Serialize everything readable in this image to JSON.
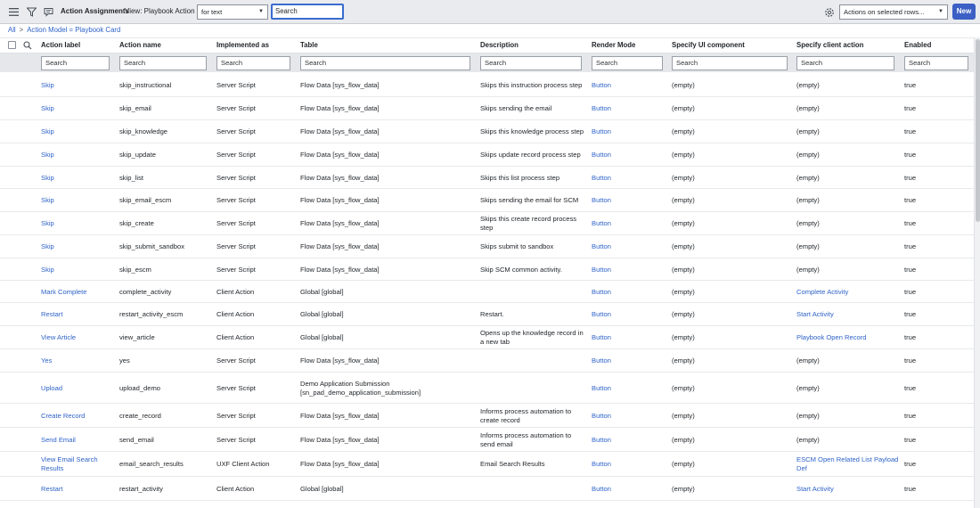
{
  "header": {
    "title": "Action Assignments",
    "view_label": "View: Playbook Action",
    "search_field": "for text",
    "search_placeholder": "Search",
    "actions_select": "Actions on selected rows...",
    "new_button": "New",
    "icons": [
      "hamburger-menu-icon",
      "filter-icon",
      "chat-bubble-icon",
      "gear-icon"
    ]
  },
  "breadcrumb": {
    "all": "All",
    "separator": ">",
    "filter": "Action Model = Playbook Card"
  },
  "columns": [
    "Action label",
    "Action name",
    "Implemented as",
    "Table",
    "Description",
    "Render Mode",
    "Specify UI component",
    "Specify client action",
    "Enabled"
  ],
  "filter_placeholder": "Search",
  "rows": [
    {
      "label": "Skip",
      "name": "skip_instructional",
      "impl": "Server Script",
      "table": "Flow Data [sys_flow_data]",
      "desc": "Skips this instruction process step",
      "render": "Button",
      "ui": "(empty)",
      "client": "(empty)",
      "enabled": "true"
    },
    {
      "label": "Skip",
      "name": "skip_email",
      "impl": "Server Script",
      "table": "Flow Data [sys_flow_data]",
      "desc": "Skips sending the email",
      "render": "Button",
      "ui": "(empty)",
      "client": "(empty)",
      "enabled": "true"
    },
    {
      "label": "Skip",
      "name": "skip_knowledge",
      "impl": "Server Script",
      "table": "Flow Data [sys_flow_data]",
      "desc": "Skips this knowledge process step",
      "render": "Button",
      "ui": "(empty)",
      "client": "(empty)",
      "enabled": "true"
    },
    {
      "label": "Skip",
      "name": "skip_update",
      "impl": "Server Script",
      "table": "Flow Data [sys_flow_data]",
      "desc": "Skips update record process step",
      "render": "Button",
      "ui": "(empty)",
      "client": "(empty)",
      "enabled": "true"
    },
    {
      "label": "Skip",
      "name": "skip_list",
      "impl": "Server Script",
      "table": "Flow Data [sys_flow_data]",
      "desc": "Skips this list process step",
      "render": "Button",
      "ui": "(empty)",
      "client": "(empty)",
      "enabled": "true"
    },
    {
      "label": "Skip",
      "name": "skip_email_escm",
      "impl": "Server Script",
      "table": "Flow Data [sys_flow_data]",
      "desc": "Skips sending the email for SCM",
      "render": "Button",
      "ui": "(empty)",
      "client": "(empty)",
      "enabled": "true"
    },
    {
      "label": "Skip",
      "name": "skip_create",
      "impl": "Server Script",
      "table": "Flow Data [sys_flow_data]",
      "desc": "Skips this create record process step",
      "render": "Button",
      "ui": "(empty)",
      "client": "(empty)",
      "enabled": "true"
    },
    {
      "label": "Skip",
      "name": "skip_submit_sandbox",
      "impl": "Server Script",
      "table": "Flow Data [sys_flow_data]",
      "desc": "Skips submit to sandbox",
      "render": "Button",
      "ui": "(empty)",
      "client": "(empty)",
      "enabled": "true"
    },
    {
      "label": "Skip",
      "name": "skip_escm",
      "impl": "Server Script",
      "table": "Flow Data [sys_flow_data]",
      "desc": "Skip SCM common activity.",
      "render": "Button",
      "ui": "(empty)",
      "client": "(empty)",
      "enabled": "true"
    },
    {
      "label": "Mark Complete",
      "name": "complete_activity",
      "impl": "Client Action",
      "table": "Global [global]",
      "desc": "",
      "render": "Button",
      "ui": "(empty)",
      "client": "Complete Activity",
      "client_link": true,
      "enabled": "true"
    },
    {
      "label": "Restart",
      "name": "restart_activity_escm",
      "impl": "Client Action",
      "table": "Global [global]",
      "desc": "Restart.",
      "render": "Button",
      "ui": "(empty)",
      "client": "Start Activity",
      "client_link": true,
      "enabled": "true"
    },
    {
      "label": "View Article",
      "name": "view_article",
      "impl": "Client Action",
      "table": "Global [global]",
      "desc": "Opens up the knowledge record in a new tab",
      "render": "Button",
      "ui": "(empty)",
      "client": "Playbook Open Record",
      "client_link": true,
      "enabled": "true"
    },
    {
      "label": "Yes",
      "name": "yes",
      "impl": "Server Script",
      "table": "Flow Data [sys_flow_data]",
      "desc": "",
      "render": "Button",
      "ui": "(empty)",
      "client": "(empty)",
      "enabled": "true"
    },
    {
      "label": "Upload",
      "name": "upload_demo",
      "impl": "Server Script",
      "table": "Demo Application Submission [sn_pad_demo_application_submission]",
      "desc": "",
      "render": "Button",
      "ui": "(empty)",
      "client": "(empty)",
      "enabled": "true"
    },
    {
      "label": "Create Record",
      "name": "create_record",
      "impl": "Server Script",
      "table": "Flow Data [sys_flow_data]",
      "desc": "Informs process automation to create record",
      "render": "Button",
      "ui": "(empty)",
      "client": "(empty)",
      "enabled": "true"
    },
    {
      "label": "Send Email",
      "name": "send_email",
      "impl": "Server Script",
      "table": "Flow Data [sys_flow_data]",
      "desc": "Informs process automation to send email",
      "render": "Button",
      "ui": "(empty)",
      "client": "(empty)",
      "enabled": "true"
    },
    {
      "label": "View Email Search Results",
      "name": "email_search_results",
      "impl": "UXF Client Action",
      "table": "Flow Data [sys_flow_data]",
      "desc": "Email Search Results",
      "render": "Button",
      "ui": "(empty)",
      "client": "ESCM Open Related List Payload Def",
      "client_link": true,
      "enabled": "true"
    },
    {
      "label": "Restart",
      "name": "restart_activity",
      "impl": "Client Action",
      "table": "Global [global]",
      "desc": "",
      "render": "Button",
      "ui": "(empty)",
      "client": "Start Activity",
      "client_link": true,
      "enabled": "true"
    }
  ],
  "colors": {
    "link": "#2f63c8",
    "header_bg": "#e9ebee",
    "new_button": "#3b5fc4",
    "focus_border": "#3a6bd0"
  }
}
